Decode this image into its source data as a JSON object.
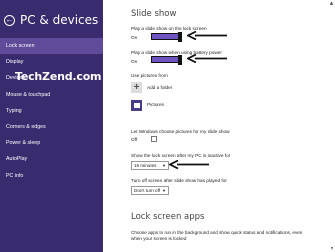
{
  "sidebar": {
    "title": "PC & devices",
    "items": [
      {
        "label": "Lock screen",
        "active": true
      },
      {
        "label": "Display"
      },
      {
        "label": "Devices"
      },
      {
        "label": "Mouse & touchpad"
      },
      {
        "label": "Typing"
      },
      {
        "label": "Corners & edges"
      },
      {
        "label": "Power & sleep"
      },
      {
        "label": "AutoPlay"
      },
      {
        "label": "PC info"
      }
    ]
  },
  "watermark": "TechZend.com",
  "slideshow": {
    "heading": "Slide show",
    "lock_label": "Play a slide show on the lock screen",
    "lock_state": "On",
    "battery_label": "Play a slide show when using battery power",
    "battery_state": "On",
    "use_pictures_label": "Use pictures from",
    "add_folder": "Add a folder",
    "pictures": "Pictures",
    "choose_label": "Let Windows choose pictures for my slide show",
    "choose_state": "Off",
    "inactive_label": "Show the lock screen after my PC is inactive for",
    "inactive_value": "15 minutes",
    "turnoff_label": "Turn off screen after slide show has played for",
    "turnoff_value": "Don't turn off"
  },
  "lock_apps": {
    "heading": "Lock screen apps",
    "description_line1": "Choose apps to run in the background and show quick status and notifications, even",
    "description_line2": "when your screen is locked"
  },
  "colors": {
    "sidebar_bg": "#3a2a6e",
    "sidebar_active": "#5f4b99",
    "toggle_on": "#6e54c0"
  }
}
